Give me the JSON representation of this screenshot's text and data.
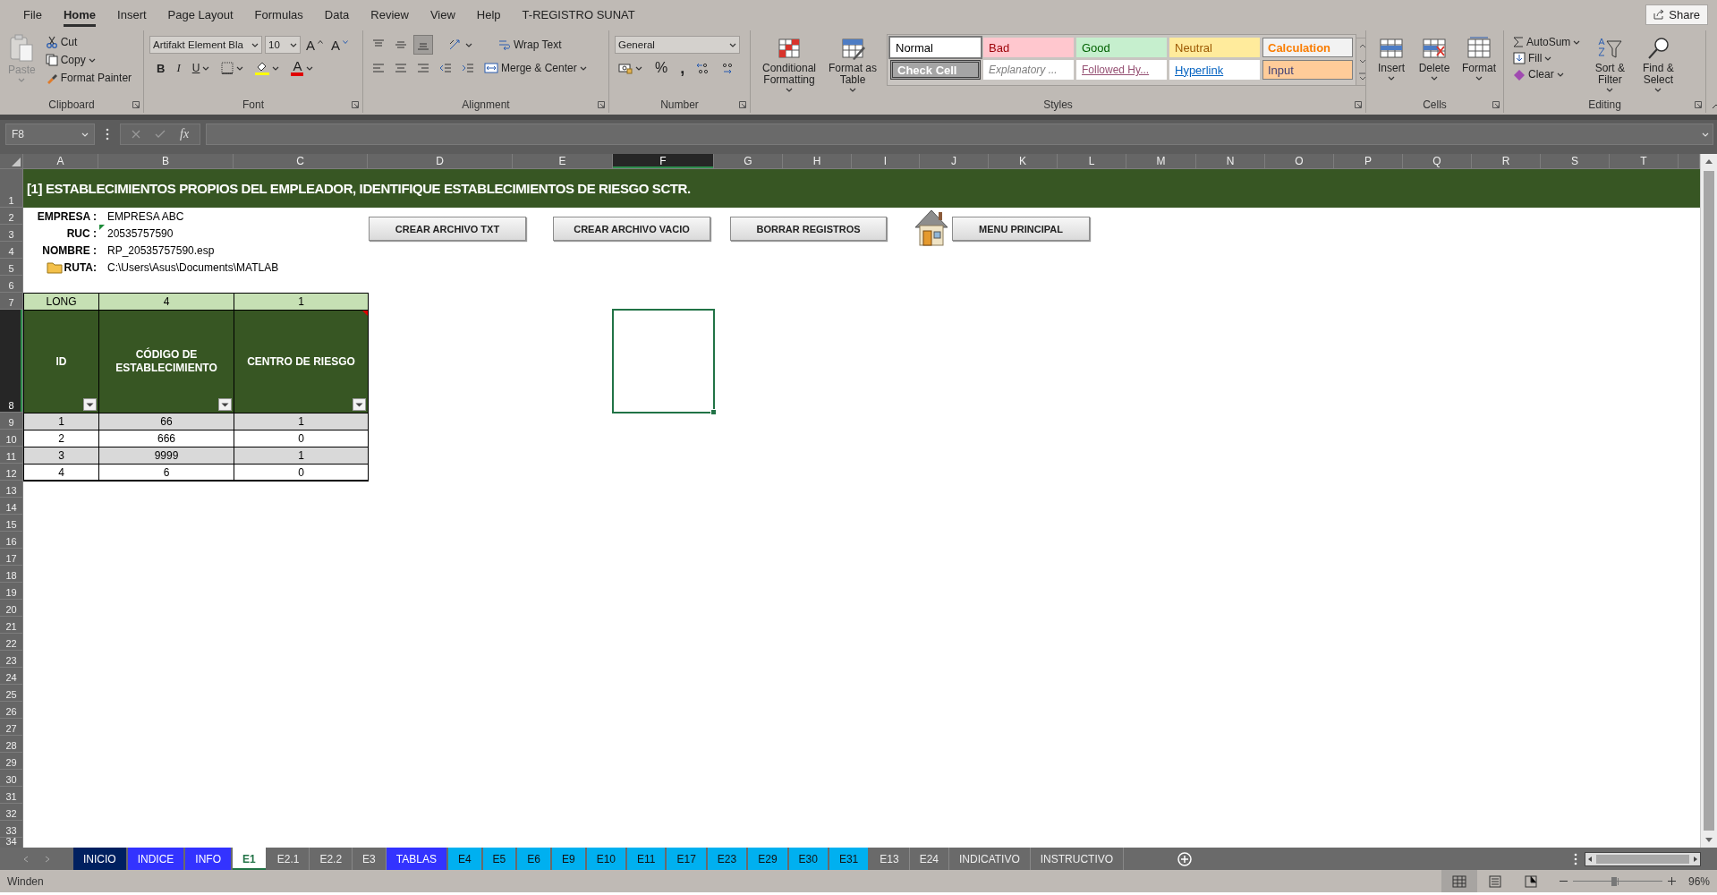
{
  "menu_tabs": [
    {
      "label": "File",
      "selected": false
    },
    {
      "label": "Home",
      "selected": true
    },
    {
      "label": "Insert",
      "selected": false
    },
    {
      "label": "Page Layout",
      "selected": false
    },
    {
      "label": "Formulas",
      "selected": false
    },
    {
      "label": "Data",
      "selected": false
    },
    {
      "label": "Review",
      "selected": false
    },
    {
      "label": "View",
      "selected": false
    },
    {
      "label": "Help",
      "selected": false
    },
    {
      "label": "T-REGISTRO SUNAT",
      "selected": false
    }
  ],
  "share_button": "Share",
  "ribbon": {
    "clipboard": {
      "label": "Clipboard",
      "paste": {
        "label": "Paste",
        "disabled": true
      },
      "cut": "Cut",
      "copy": "Copy",
      "format_painter": "Format Painter"
    },
    "font": {
      "label": "Font",
      "font_name": "Artifakt Element Bla",
      "font_size": "10",
      "grow": "A",
      "shrink": "A",
      "bold": "B",
      "italic": "I",
      "underline": "U",
      "font_color": "A"
    },
    "alignment": {
      "label": "Alignment",
      "wrap_text": "Wrap Text",
      "merge_center": "Merge & Center"
    },
    "number": {
      "label": "Number",
      "format": "General",
      "percent": "%",
      "comma": ","
    },
    "styles": {
      "label": "Styles",
      "conditional_formatting": "Conditional Formatting",
      "format_as_table": "Format as Table",
      "gallery": [
        {
          "label": "Normal",
          "kind": "normal",
          "selected": true
        },
        {
          "label": "Bad",
          "kind": "bad",
          "selected": false
        },
        {
          "label": "Good",
          "kind": "good",
          "selected": false
        },
        {
          "label": "Neutral",
          "kind": "neutral",
          "selected": false
        },
        {
          "label": "Calculation",
          "kind": "calculation",
          "selected": false
        },
        {
          "label": "Check Cell",
          "kind": "check",
          "selected": false
        },
        {
          "label": "Explanatory ...",
          "kind": "explanatory",
          "selected": false
        },
        {
          "label": "Followed Hy...",
          "kind": "followed",
          "selected": false
        },
        {
          "label": "Hyperlink",
          "kind": "hyperlink",
          "selected": false
        },
        {
          "label": "Input",
          "kind": "input",
          "selected": false
        }
      ]
    },
    "cells": {
      "label": "Cells",
      "insert": "Insert",
      "delete": "Delete",
      "format": "Format"
    },
    "editing": {
      "label": "Editing",
      "autosum": "AutoSum",
      "fill": "Fill",
      "clear": "Clear",
      "sort_filter": "Sort & Filter",
      "find_select": "Find & Select"
    }
  },
  "formula_bar": {
    "name_box": "F8",
    "function_label": "fx"
  },
  "sheet": {
    "columns": [
      {
        "label": "A",
        "selected": false
      },
      {
        "label": "B",
        "selected": false
      },
      {
        "label": "C",
        "selected": false
      },
      {
        "label": "D",
        "selected": false
      },
      {
        "label": "E",
        "selected": false
      },
      {
        "label": "F",
        "selected": true
      },
      {
        "label": "G",
        "selected": false
      },
      {
        "label": "H",
        "selected": false
      },
      {
        "label": "I",
        "selected": false
      },
      {
        "label": "J",
        "selected": false
      },
      {
        "label": "K",
        "selected": false
      },
      {
        "label": "L",
        "selected": false
      },
      {
        "label": "M",
        "selected": false
      },
      {
        "label": "N",
        "selected": false
      },
      {
        "label": "O",
        "selected": false
      },
      {
        "label": "P",
        "selected": false
      },
      {
        "label": "Q",
        "selected": false
      },
      {
        "label": "R",
        "selected": false
      },
      {
        "label": "S",
        "selected": false
      },
      {
        "label": "T",
        "selected": false
      }
    ],
    "rows": [
      {
        "label": "1",
        "selected": false
      },
      {
        "label": "2",
        "selected": false
      },
      {
        "label": "3",
        "selected": false
      },
      {
        "label": "4",
        "selected": false
      },
      {
        "label": "5",
        "selected": false
      },
      {
        "label": "6",
        "selected": false
      },
      {
        "label": "7",
        "selected": false
      },
      {
        "label": "8",
        "selected": true
      },
      {
        "label": "9",
        "selected": false
      },
      {
        "label": "10",
        "selected": false
      },
      {
        "label": "11",
        "selected": false
      },
      {
        "label": "12",
        "selected": false
      },
      {
        "label": "13",
        "selected": false
      },
      {
        "label": "14",
        "selected": false
      },
      {
        "label": "15",
        "selected": false
      },
      {
        "label": "16",
        "selected": false
      },
      {
        "label": "17",
        "selected": false
      },
      {
        "label": "18",
        "selected": false
      },
      {
        "label": "19",
        "selected": false
      },
      {
        "label": "20",
        "selected": false
      },
      {
        "label": "21",
        "selected": false
      },
      {
        "label": "22",
        "selected": false
      },
      {
        "label": "23",
        "selected": false
      },
      {
        "label": "24",
        "selected": false
      },
      {
        "label": "25",
        "selected": false
      },
      {
        "label": "26",
        "selected": false
      },
      {
        "label": "27",
        "selected": false
      },
      {
        "label": "28",
        "selected": false
      },
      {
        "label": "29",
        "selected": false
      },
      {
        "label": "30",
        "selected": false
      },
      {
        "label": "31",
        "selected": false
      },
      {
        "label": "32",
        "selected": false
      },
      {
        "label": "33",
        "selected": false
      },
      {
        "label": "34",
        "selected": false
      }
    ],
    "title": "[1] ESTABLECIMIENTOS PROPIOS DEL EMPLEADOR, IDENTIFIQUE ESTABLECIMIENTOS DE RIESGO SCTR.",
    "info": [
      {
        "label": "EMPRESA :",
        "value": "EMPRESA ABC",
        "kind": "plain"
      },
      {
        "label": "RUC :",
        "value": "20535757590",
        "kind": "flagged"
      },
      {
        "label": "NOMBRE :",
        "value": "RP_20535757590.esp",
        "kind": "plain"
      },
      {
        "label": "RUTA:",
        "value": "C:\\Users\\Asus\\Documents\\MATLAB",
        "kind": "folder"
      }
    ],
    "buttons": [
      {
        "label": "CREAR ARCHIVO TXT",
        "kind": "plain"
      },
      {
        "label": "CREAR ARCHIVO VACIO",
        "kind": "plain"
      },
      {
        "label": "BORRAR REGISTROS",
        "kind": "plain"
      },
      {
        "label": "MENU PRINCIPAL",
        "kind": "home"
      }
    ],
    "table": {
      "lengths": [
        "LONG",
        "4",
        "1"
      ],
      "columns": [
        {
          "label": "ID",
          "comment": false
        },
        {
          "label": "CÓDIGO DE ESTABLECIMIENTO",
          "comment": false
        },
        {
          "label": "CENTRO DE RIESGO",
          "comment": true
        }
      ],
      "rows": [
        [
          "1",
          "66",
          "1"
        ],
        [
          "2",
          "666",
          "0"
        ],
        [
          "3",
          "9999",
          "1"
        ],
        [
          "4",
          "6",
          "0"
        ]
      ]
    }
  },
  "sheet_tabs": [
    {
      "label": "INICIO",
      "color": "#002060",
      "selected": false
    },
    {
      "label": "INDICE",
      "color": "#3333ff",
      "selected": false
    },
    {
      "label": "INFO",
      "color": "#3333ff",
      "selected": false
    },
    {
      "label": "E1",
      "selected": true
    },
    {
      "label": "E2.1",
      "selected": false
    },
    {
      "label": "E2.2",
      "selected": false
    },
    {
      "label": "E3",
      "selected": false
    },
    {
      "label": "TABLAS",
      "color": "#3333ff",
      "selected": false
    },
    {
      "label": "E4",
      "color": "#00b0f0",
      "selected": false
    },
    {
      "label": "E5",
      "color": "#00b0f0",
      "selected": false
    },
    {
      "label": "E6",
      "color": "#00b0f0",
      "selected": false
    },
    {
      "label": "E9",
      "color": "#00b0f0",
      "selected": false
    },
    {
      "label": "E10",
      "color": "#00b0f0",
      "selected": false
    },
    {
      "label": "E11",
      "color": "#00b0f0",
      "selected": false
    },
    {
      "label": "E17",
      "color": "#00b0f0",
      "selected": false
    },
    {
      "label": "E23",
      "color": "#00b0f0",
      "selected": false
    },
    {
      "label": "E29",
      "color": "#00b0f0",
      "selected": false
    },
    {
      "label": "E30",
      "color": "#00b0f0",
      "selected": false
    },
    {
      "label": "E31",
      "color": "#00b0f0",
      "selected": false
    },
    {
      "label": "E13",
      "selected": false
    },
    {
      "label": "E24",
      "selected": false
    },
    {
      "label": "INDICATIVO",
      "selected": false
    },
    {
      "label": "INSTRUCTIVO",
      "selected": false
    }
  ],
  "status_bar": {
    "text": "Winden",
    "views": [
      {
        "kind": "normal",
        "selected": true
      },
      {
        "kind": "page_layout",
        "selected": false
      },
      {
        "kind": "page_break",
        "selected": false
      }
    ],
    "zoom_slider": {
      "level": 0.46
    },
    "zoom": "96%"
  }
}
